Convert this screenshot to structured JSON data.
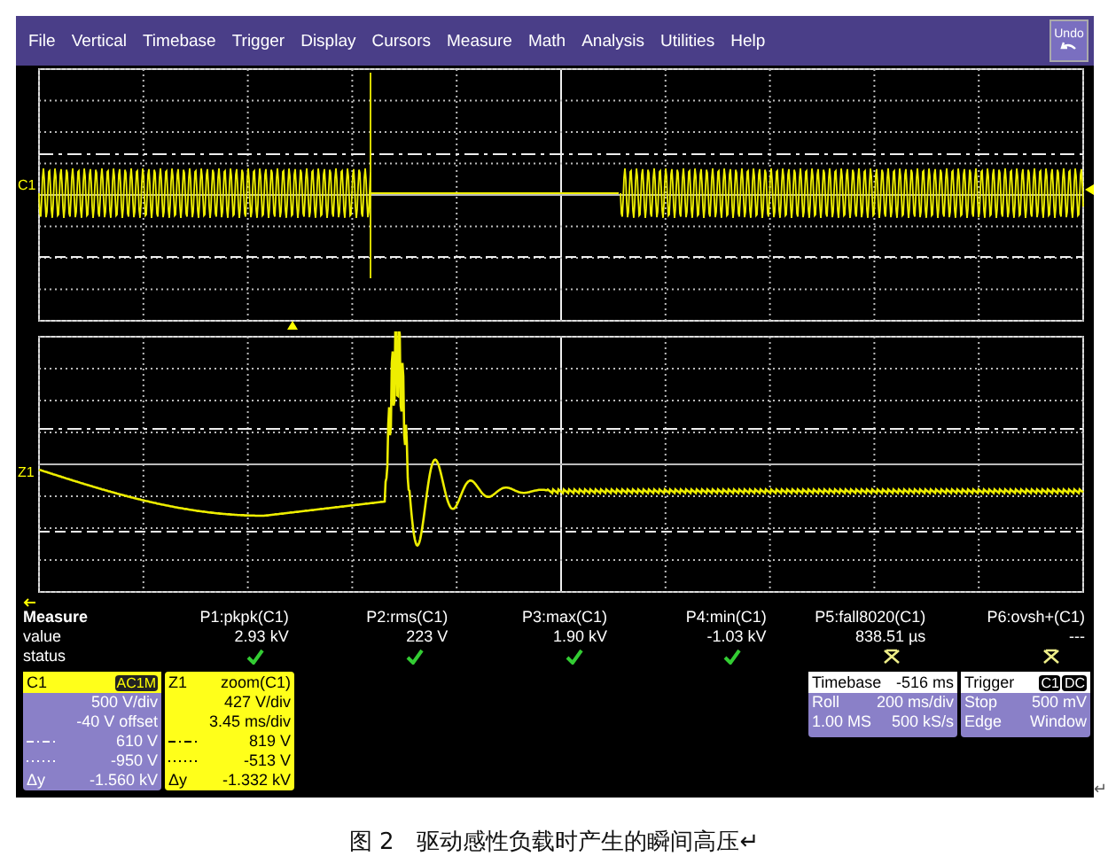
{
  "menu": [
    "File",
    "Vertical",
    "Timebase",
    "Trigger",
    "Display",
    "Cursors",
    "Measure",
    "Math",
    "Analysis",
    "Utilities",
    "Help"
  ],
  "undo_button": "Undo",
  "upper_grid": {
    "trace_label": "C1"
  },
  "lower_grid": {
    "trace_label": "Z1"
  },
  "measure": {
    "title": "Measure",
    "row_labels": [
      "value",
      "status"
    ],
    "params": [
      {
        "name": "P1:pkpk(C1)",
        "value": "2.93 kV",
        "valid": true
      },
      {
        "name": "P2:rms(C1)",
        "value": "223 V",
        "valid": true
      },
      {
        "name": "P3:max(C1)",
        "value": "1.90 kV",
        "valid": true
      },
      {
        "name": "P4:min(C1)",
        "value": "-1.03 kV",
        "valid": true
      },
      {
        "name": "P5:fall8020(C1)",
        "value": "838.51 µs",
        "valid": false
      },
      {
        "name": "P6:ovsh+(C1)",
        "value": "---",
        "valid": false
      }
    ]
  },
  "channel_panel": {
    "name": "C1",
    "badge": "AC1M",
    "rows": [
      {
        "kind": "text",
        "value": "500 V/div"
      },
      {
        "kind": "text",
        "value": "-40 V offset"
      },
      {
        "kind": "dashdot",
        "value": "610 V"
      },
      {
        "kind": "dotted",
        "value": "-950 V"
      },
      {
        "kind": "delta",
        "label": "Δy",
        "value": "-1.560 kV"
      }
    ]
  },
  "zoom_panel": {
    "name": "Z1",
    "source": "zoom(C1)",
    "rows": [
      {
        "kind": "text",
        "value": "427 V/div"
      },
      {
        "kind": "text",
        "value": "3.45 ms/div"
      },
      {
        "kind": "dashdot",
        "value": "819 V"
      },
      {
        "kind": "dotted",
        "value": "-513 V"
      },
      {
        "kind": "delta",
        "label": "Δy",
        "value": "-1.332 kV"
      }
    ]
  },
  "timebase_panel": {
    "title": "Timebase",
    "value": "-516 ms",
    "rows": [
      [
        "Roll",
        "200 ms/div"
      ],
      [
        "1.00 MS",
        "500 kS/s"
      ]
    ]
  },
  "trigger_panel": {
    "title": "Trigger",
    "badges": [
      "C1",
      "DC"
    ],
    "rows": [
      [
        "Stop",
        "500 mV"
      ],
      [
        "Edge",
        "Window"
      ]
    ]
  },
  "paragraph_mark": "↵",
  "caption": "图 2　驱动感性负载时产生的瞬间高压↵"
}
